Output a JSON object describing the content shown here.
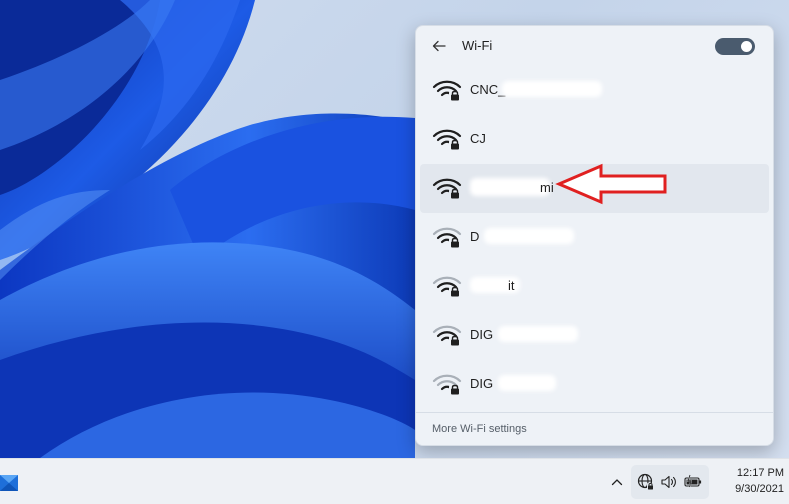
{
  "wifi_panel": {
    "title": "Wi-Fi",
    "toggle_on": true,
    "networks": [
      {
        "name": "CNC_",
        "secured": true,
        "signal": "full",
        "selected": false
      },
      {
        "name": "CJ",
        "secured": true,
        "signal": "full",
        "selected": false
      },
      {
        "name": "mi",
        "secured": true,
        "signal": "full",
        "selected": true
      },
      {
        "name": "D",
        "secured": true,
        "signal": "medium",
        "selected": false
      },
      {
        "name": "it",
        "secured": true,
        "signal": "medium",
        "selected": false
      },
      {
        "name": "DIG",
        "secured": true,
        "signal": "medium",
        "selected": false
      },
      {
        "name": "DIG",
        "secured": true,
        "signal": "low",
        "selected": false
      }
    ],
    "more_settings_label": "More Wi-Fi settings"
  },
  "taskbar": {
    "time": "12:17 PM",
    "date": "9/30/2021"
  },
  "colors": {
    "annotation_arrow": "#e02020",
    "toggle_track": "#4a5b6e",
    "wallpaper_blue": "#1a4fd8"
  }
}
